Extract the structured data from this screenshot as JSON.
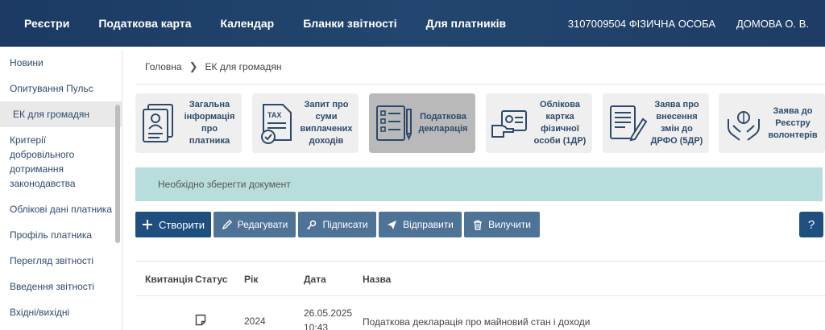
{
  "topnav": {
    "items": [
      "Реєстри",
      "Податкова карта",
      "Календар",
      "Бланки звітності",
      "Для платників"
    ],
    "taxpayer": "3107009504 ФІЗИЧНА ОСОБА",
    "user": "ДОМОВА О. В."
  },
  "sidebar": {
    "items": [
      "Новини",
      "Опитування Пульс",
      "ЕК для громадян",
      "Критерії добровільного дотримання законодавства",
      "Облікові дані платника",
      "Профіль платника",
      "Перегляд звітності",
      "Введення звітності",
      "Вхідні/вихідні"
    ],
    "active_index": 2
  },
  "breadcrumb": {
    "home": "Головна",
    "current": "ЕК для громадян"
  },
  "cards": [
    {
      "label": "Загальна інформація про платника",
      "icon": "profile-document-icon"
    },
    {
      "label": "Запит про суми виплачених доходів",
      "icon": "tax-document-icon"
    },
    {
      "label": "Податкова декларація",
      "icon": "checklist-icon"
    },
    {
      "label": "Облікова картка фізичної особи (1ДР)",
      "icon": "id-card-hand-icon"
    },
    {
      "label": "Заява про внесення змін до ДРФО (5ДР)",
      "icon": "form-edit-icon"
    },
    {
      "label": "Заява до Реєстру волонтерів",
      "icon": "volunteer-hands-icon"
    }
  ],
  "active_card_index": 2,
  "notice": "Необхідно зберегти документ",
  "toolbar": {
    "create": "Створити",
    "edit": "Редагувати",
    "sign": "Підписати",
    "send": "Відправити",
    "delete": "Вилучити",
    "help": "?"
  },
  "table": {
    "headers": [
      "Квитанція",
      "Статус",
      "Рік",
      "Дата",
      "Назва"
    ],
    "rows": [
      {
        "receipt": "",
        "status_icon": "note-icon",
        "year": "2024",
        "date": "26.05.2025",
        "time": "10:43",
        "name": "Податкова декларація про майновий стан і доходи"
      }
    ]
  },
  "colors": {
    "header_bg": "#1e3c66",
    "primary_button": "#1f4f7f",
    "secondary_button": "#4f7397",
    "notice_bg": "#b7dedb",
    "active_card": "#b9b9b9"
  }
}
